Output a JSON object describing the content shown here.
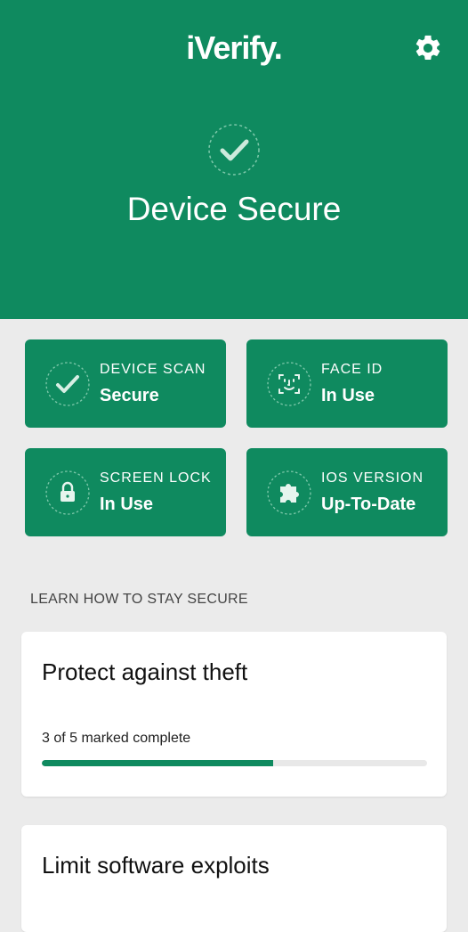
{
  "app": {
    "logo": "iVerify."
  },
  "hero": {
    "status_title": "Device Secure"
  },
  "tiles": [
    {
      "label": "DEVICE SCAN",
      "value": "Secure",
      "icon": "check-icon"
    },
    {
      "label": "FACE ID",
      "value": "In Use",
      "icon": "face-id-icon"
    },
    {
      "label": "SCREEN LOCK",
      "value": "In Use",
      "icon": "lock-icon"
    },
    {
      "label": "IOS VERSION",
      "value": "Up-To-Date",
      "icon": "puzzle-icon"
    }
  ],
  "learn": {
    "section_label": "LEARN HOW TO STAY SECURE",
    "cards": [
      {
        "title": "Protect against theft",
        "progress_text": "3 of 5 marked complete",
        "completed": 3,
        "total": 5
      },
      {
        "title": "Limit software exploits"
      }
    ]
  },
  "colors": {
    "brand_green": "#0f8a5f",
    "background": "#ebebeb",
    "card": "#ffffff"
  }
}
